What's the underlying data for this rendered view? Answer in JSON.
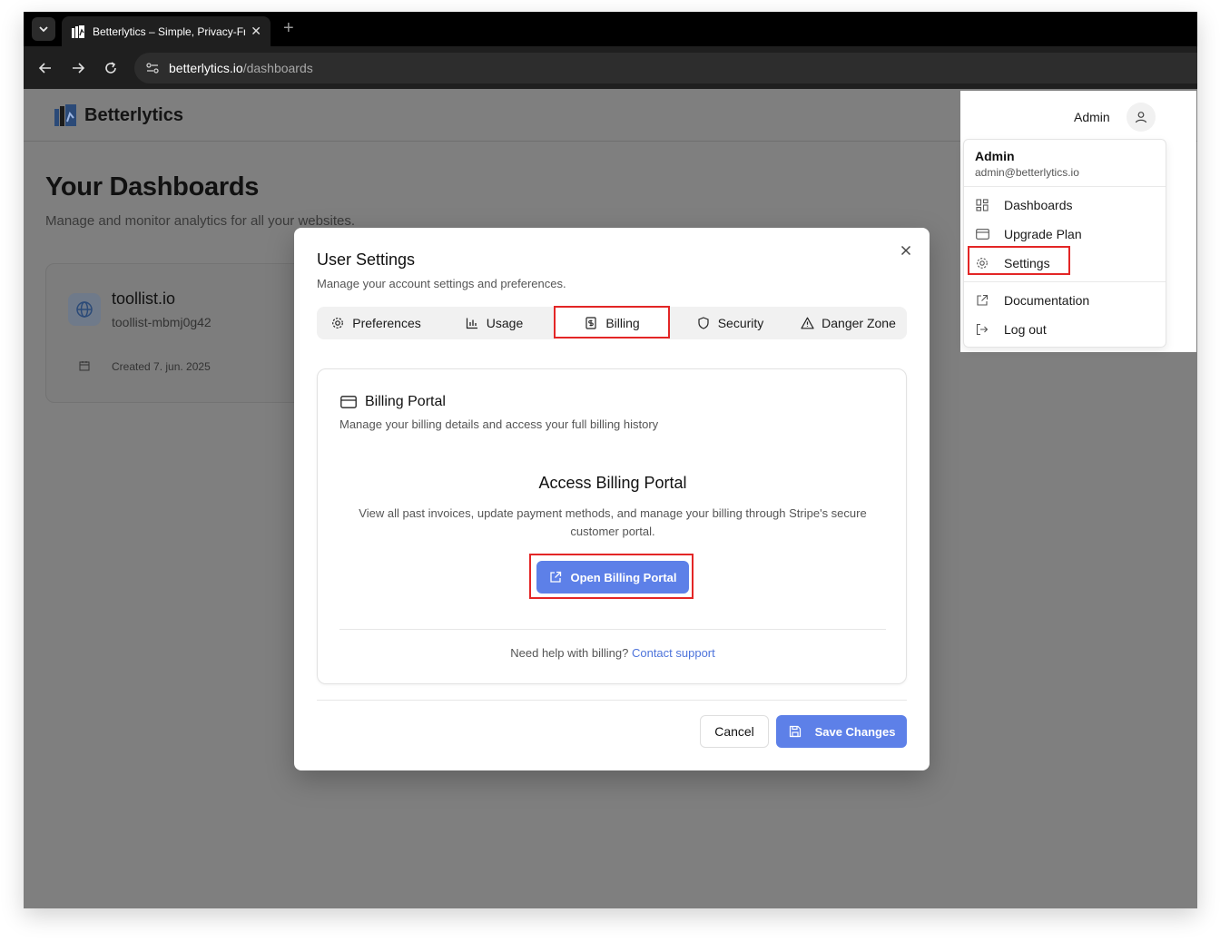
{
  "browser": {
    "tab_title": "Betterlytics – Simple, Privacy-Friendly Analytics",
    "url_host": "betterlytics.io",
    "url_path": "/dashboards",
    "new_tab_symbol": "+",
    "close_symbol": "✕"
  },
  "app": {
    "brand": "Betterlytics",
    "page_title": "Your Dashboards",
    "page_subtitle": "Manage and monitor analytics for all your websites.",
    "site": {
      "name": "toollist.io",
      "id": "toollist-mbmj0g42",
      "created": "Created 7. jun. 2025"
    }
  },
  "user_menu": {
    "trigger_label": "Admin",
    "name": "Admin",
    "email": "admin@betterlytics.io",
    "items": [
      {
        "label": "Dashboards",
        "icon": "grid-icon"
      },
      {
        "label": "Upgrade Plan",
        "icon": "credit-card-icon"
      },
      {
        "label": "Settings",
        "icon": "gear-icon"
      },
      {
        "label": "Documentation",
        "icon": "external-link-icon"
      },
      {
        "label": "Log out",
        "icon": "logout-icon"
      }
    ]
  },
  "modal": {
    "title": "User Settings",
    "description": "Manage your account settings and preferences.",
    "tabs": [
      {
        "label": "Preferences",
        "icon": "gear-icon"
      },
      {
        "label": "Usage",
        "icon": "bar-chart-icon"
      },
      {
        "label": "Billing",
        "icon": "receipt-icon"
      },
      {
        "label": "Security",
        "icon": "shield-icon"
      },
      {
        "label": "Danger Zone",
        "icon": "warning-icon"
      }
    ],
    "active_tab": "Billing",
    "billing": {
      "heading": "Billing Portal",
      "subheading": "Manage your billing details and access your full billing history",
      "access_title": "Access Billing Portal",
      "access_desc": "View all past invoices, update payment methods, and manage your billing through Stripe's secure customer portal.",
      "portal_button": "Open Billing Portal",
      "help_text": "Need help with billing?",
      "help_link": "Contact support"
    },
    "cancel_label": "Cancel",
    "save_label": "Save Changes"
  },
  "colors": {
    "accent": "#5d80e8",
    "link": "#4e74db",
    "highlight": "#e32626",
    "overlay": "#7f7f7f"
  }
}
